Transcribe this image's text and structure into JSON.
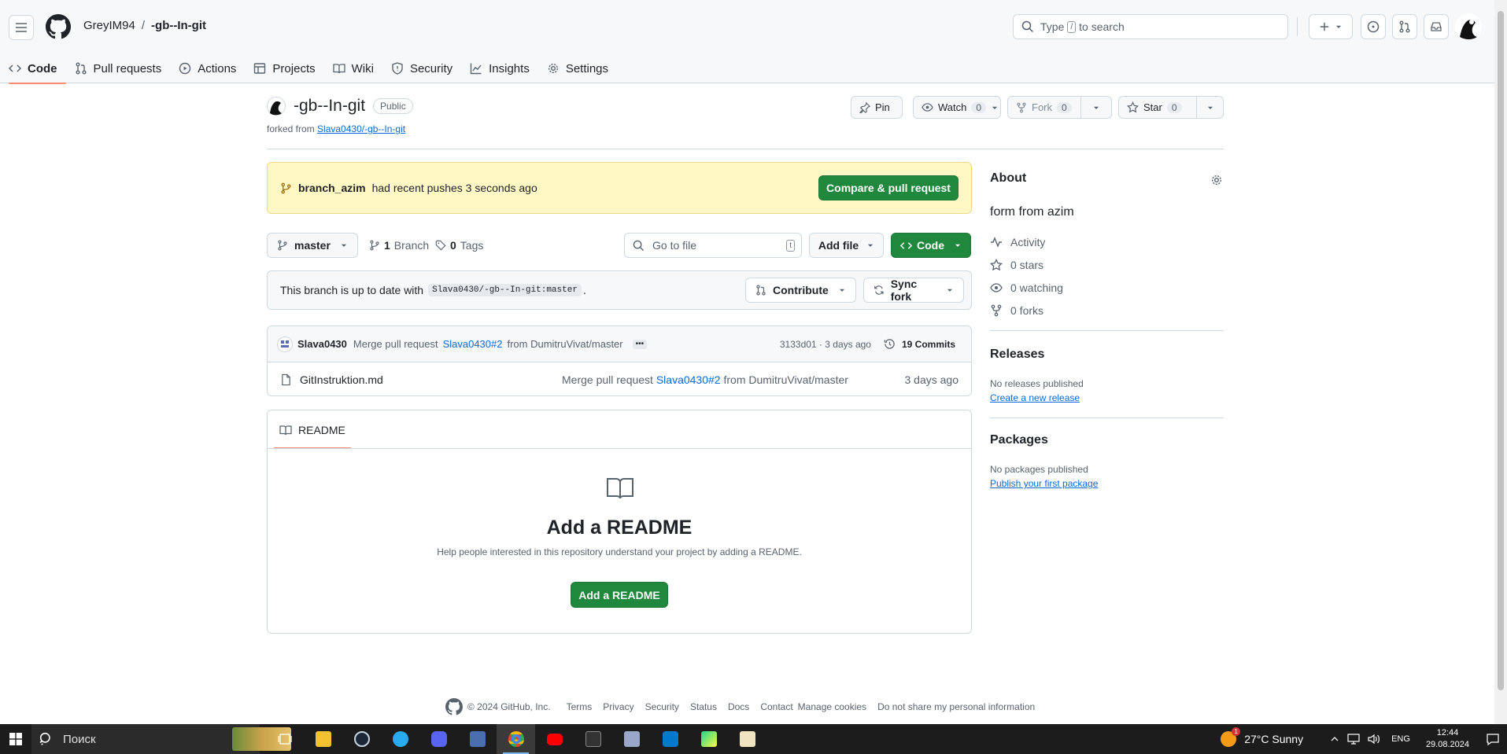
{
  "header": {
    "owner": "GreyIM94",
    "separator": "/",
    "repo": "-gb--In-git",
    "search_prefix": "Type",
    "search_key": "/",
    "search_suffix": "to search"
  },
  "tabs": [
    {
      "label": "Code",
      "icon": "code-icon"
    },
    {
      "label": "Pull requests",
      "icon": "git-pull-request-icon"
    },
    {
      "label": "Actions",
      "icon": "play-icon"
    },
    {
      "label": "Projects",
      "icon": "table-icon"
    },
    {
      "label": "Wiki",
      "icon": "book-icon"
    },
    {
      "label": "Security",
      "icon": "shield-icon"
    },
    {
      "label": "Insights",
      "icon": "graph-icon"
    },
    {
      "label": "Settings",
      "icon": "gear-icon"
    }
  ],
  "repo": {
    "name": "-gb--In-git",
    "visibility": "Public",
    "forked_prefix": "forked from",
    "forked_from": "Slava0430/-gb--In-git",
    "pin_label": "Pin",
    "watch_label": "Watch",
    "watch_count": "0",
    "fork_label": "Fork",
    "fork_count": "0",
    "star_label": "Star",
    "star_count": "0"
  },
  "push_banner": {
    "branch": "branch_azim",
    "text": "had recent pushes 3 seconds ago",
    "button": "Compare & pull request"
  },
  "branch_bar": {
    "branch": "master",
    "branches_count": "1",
    "branches_label": "Branch",
    "tags_count": "0",
    "tags_label": "Tags",
    "goto_placeholder": "Go to file",
    "goto_key": "t",
    "add_file": "Add file",
    "code": "Code"
  },
  "sync": {
    "text": "This branch is up to date with",
    "ref": "Slava0430/-gb--In-git:master",
    "period": ".",
    "contribute": "Contribute",
    "sync_fork": "Sync fork"
  },
  "commit": {
    "author": "Slava0430",
    "msg_prefix": "Merge pull request",
    "pr_link": "Slava0430#2",
    "msg_suffix": "from DumitruVivat/master",
    "ellipsis": "•••",
    "hash_age": "3133d01 · 3 days ago",
    "commits": "19 Commits"
  },
  "files": [
    {
      "name": "GitInstruktion.md",
      "msg_prefix": "Merge pull request",
      "msg_link": "Slava0430#2",
      "msg_suffix": "from DumitruVivat/master",
      "age": "3 days ago"
    }
  ],
  "readme": {
    "tab": "README",
    "heading": "Add a README",
    "desc": "Help people interested in this repository understand your project by adding a README.",
    "button": "Add a README"
  },
  "sidebar": {
    "about_title": "About",
    "description": "form from azim",
    "activity": "Activity",
    "stars": "0 stars",
    "watching": "0 watching",
    "forks": "0 forks",
    "releases_title": "Releases",
    "releases_none": "No releases published",
    "releases_link": "Create a new release",
    "packages_title": "Packages",
    "packages_none": "No packages published",
    "packages_link": "Publish your first package"
  },
  "footer": {
    "copyright": "© 2024 GitHub, Inc.",
    "links": [
      "Terms",
      "Privacy",
      "Security",
      "Status",
      "Docs",
      "Contact",
      "Manage cookies",
      "Do not share my personal information"
    ]
  },
  "taskbar": {
    "search": "Поиск",
    "weather": "27°C  Sunny",
    "weather_badge": "1",
    "lang": "ENG",
    "time": "12:44",
    "date": "29.08.2024"
  },
  "colors": {
    "accent_green": "#1f883d",
    "link": "#0969da",
    "tab_underline": "#fd8c73",
    "banner_bg": "#fff8c5"
  }
}
